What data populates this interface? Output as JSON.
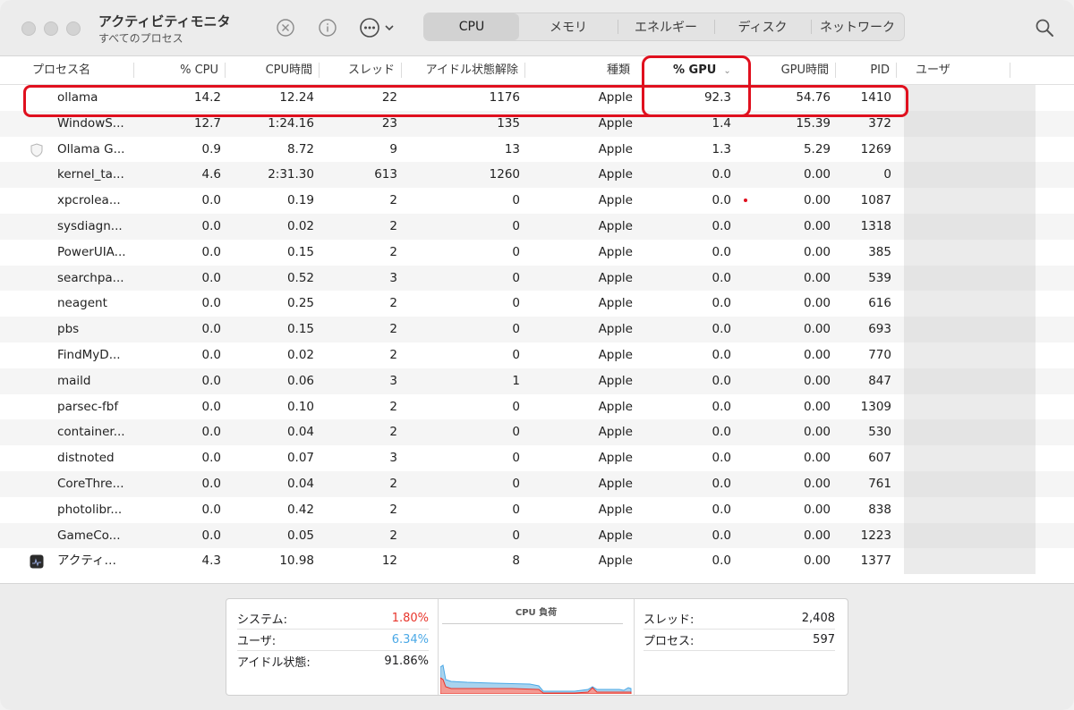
{
  "toolbar": {
    "title": "アクティビティモニタ",
    "subtitle": "すべてのプロセス",
    "tabs": [
      "CPU",
      "メモリ",
      "エネルギー",
      "ディスク",
      "ネットワーク"
    ],
    "active_tab": "CPU"
  },
  "table": {
    "headers": {
      "name": "プロセス名",
      "cpu": "% CPU",
      "cpu_time": "CPU時間",
      "threads": "スレッド",
      "idle_wakeups": "アイドル状態解除",
      "kind": "種類",
      "gpu": "% GPU",
      "gpu_time": "GPU時間",
      "pid": "PID",
      "user": "ユーザ"
    },
    "sort_column": "% GPU",
    "rows": [
      {
        "name": "ollama",
        "cpu": "14.2",
        "cpu_time": "12.24",
        "threads": "22",
        "idle": "1176",
        "kind": "Apple",
        "gpu": "92.3",
        "gpu_time": "54.76",
        "pid": "1410",
        "icon": ""
      },
      {
        "name": "WindowS...",
        "cpu": "12.7",
        "cpu_time": "1:24.16",
        "threads": "23",
        "idle": "135",
        "kind": "Apple",
        "gpu": "1.4",
        "gpu_time": "15.39",
        "pid": "372",
        "icon": ""
      },
      {
        "name": "Ollama G...",
        "cpu": "0.9",
        "cpu_time": "8.72",
        "threads": "9",
        "idle": "13",
        "kind": "Apple",
        "gpu": "1.3",
        "gpu_time": "5.29",
        "pid": "1269",
        "icon": "shield-icon"
      },
      {
        "name": "kernel_ta...",
        "cpu": "4.6",
        "cpu_time": "2:31.30",
        "threads": "613",
        "idle": "1260",
        "kind": "Apple",
        "gpu": "0.0",
        "gpu_time": "0.00",
        "pid": "0",
        "icon": ""
      },
      {
        "name": "xpcrolea...",
        "cpu": "0.0",
        "cpu_time": "0.19",
        "threads": "2",
        "idle": "0",
        "kind": "Apple",
        "gpu": "0.0",
        "gpu_time": "0.00",
        "pid": "1087",
        "icon": ""
      },
      {
        "name": "sysdiagn...",
        "cpu": "0.0",
        "cpu_time": "0.02",
        "threads": "2",
        "idle": "0",
        "kind": "Apple",
        "gpu": "0.0",
        "gpu_time": "0.00",
        "pid": "1318",
        "icon": ""
      },
      {
        "name": "PowerUIA...",
        "cpu": "0.0",
        "cpu_time": "0.15",
        "threads": "2",
        "idle": "0",
        "kind": "Apple",
        "gpu": "0.0",
        "gpu_time": "0.00",
        "pid": "385",
        "icon": ""
      },
      {
        "name": "searchpa...",
        "cpu": "0.0",
        "cpu_time": "0.52",
        "threads": "3",
        "idle": "0",
        "kind": "Apple",
        "gpu": "0.0",
        "gpu_time": "0.00",
        "pid": "539",
        "icon": ""
      },
      {
        "name": "neagent",
        "cpu": "0.0",
        "cpu_time": "0.25",
        "threads": "2",
        "idle": "0",
        "kind": "Apple",
        "gpu": "0.0",
        "gpu_time": "0.00",
        "pid": "616",
        "icon": ""
      },
      {
        "name": "pbs",
        "cpu": "0.0",
        "cpu_time": "0.15",
        "threads": "2",
        "idle": "0",
        "kind": "Apple",
        "gpu": "0.0",
        "gpu_time": "0.00",
        "pid": "693",
        "icon": ""
      },
      {
        "name": "FindMyD...",
        "cpu": "0.0",
        "cpu_time": "0.02",
        "threads": "2",
        "idle": "0",
        "kind": "Apple",
        "gpu": "0.0",
        "gpu_time": "0.00",
        "pid": "770",
        "icon": ""
      },
      {
        "name": "maild",
        "cpu": "0.0",
        "cpu_time": "0.06",
        "threads": "3",
        "idle": "1",
        "kind": "Apple",
        "gpu": "0.0",
        "gpu_time": "0.00",
        "pid": "847",
        "icon": ""
      },
      {
        "name": "parsec-fbf",
        "cpu": "0.0",
        "cpu_time": "0.10",
        "threads": "2",
        "idle": "0",
        "kind": "Apple",
        "gpu": "0.0",
        "gpu_time": "0.00",
        "pid": "1309",
        "icon": ""
      },
      {
        "name": "container...",
        "cpu": "0.0",
        "cpu_time": "0.04",
        "threads": "2",
        "idle": "0",
        "kind": "Apple",
        "gpu": "0.0",
        "gpu_time": "0.00",
        "pid": "530",
        "icon": ""
      },
      {
        "name": "distnoted",
        "cpu": "0.0",
        "cpu_time": "0.07",
        "threads": "3",
        "idle": "0",
        "kind": "Apple",
        "gpu": "0.0",
        "gpu_time": "0.00",
        "pid": "607",
        "icon": ""
      },
      {
        "name": "CoreThre...",
        "cpu": "0.0",
        "cpu_time": "0.04",
        "threads": "2",
        "idle": "0",
        "kind": "Apple",
        "gpu": "0.0",
        "gpu_time": "0.00",
        "pid": "761",
        "icon": ""
      },
      {
        "name": "photolibr...",
        "cpu": "0.0",
        "cpu_time": "0.42",
        "threads": "2",
        "idle": "0",
        "kind": "Apple",
        "gpu": "0.0",
        "gpu_time": "0.00",
        "pid": "838",
        "icon": ""
      },
      {
        "name": "GameCo...",
        "cpu": "0.0",
        "cpu_time": "0.05",
        "threads": "2",
        "idle": "0",
        "kind": "Apple",
        "gpu": "0.0",
        "gpu_time": "0.00",
        "pid": "1223",
        "icon": ""
      },
      {
        "name": "アクティ…",
        "cpu": "4.3",
        "cpu_time": "10.98",
        "threads": "12",
        "idle": "8",
        "kind": "Apple",
        "gpu": "0.0",
        "gpu_time": "0.00",
        "pid": "1377",
        "icon": "activity-monitor-icon"
      }
    ]
  },
  "summary": {
    "system_label": "システム:",
    "system_value": "1.80%",
    "user_label": "ユーザ:",
    "user_value": "6.34%",
    "idle_label": "アイドル状態:",
    "idle_value": "91.86%",
    "graph_title": "CPU 負荷",
    "threads_label": "スレッド:",
    "threads_value": "2,408",
    "processes_label": "プロセス:",
    "processes_value": "597"
  },
  "colors": {
    "system": "#e8352b",
    "user": "#4aa8e6",
    "highlight": "#e0101e"
  }
}
